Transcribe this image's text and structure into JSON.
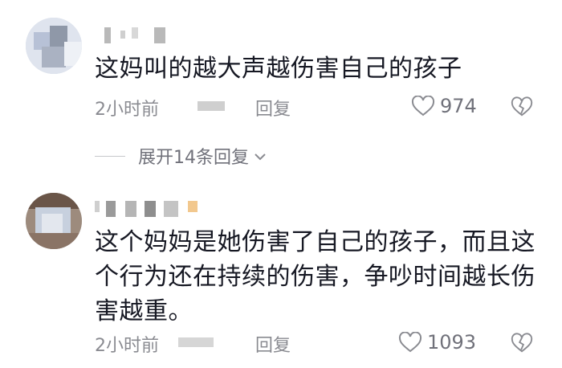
{
  "comments": [
    {
      "text": "这妈叫的越大声越伤害自己的孩子",
      "time": "2小时前",
      "reply_label": "回复",
      "likes": "974"
    },
    {
      "text": "这个妈妈是她伤害了自己的孩子，而且这个行为还在持续的伤害，争吵时间越长伤害越重。",
      "time": "2小时前",
      "reply_label": "回复",
      "likes": "1093"
    }
  ],
  "expand_replies": "展开14条回复",
  "icons": {
    "like": "heart-outline-icon",
    "dislike": "broken-heart-icon",
    "expand": "chevron-down-icon"
  },
  "colors": {
    "text": "#161823",
    "meta": "#8a8b91",
    "background": "#ffffff"
  }
}
